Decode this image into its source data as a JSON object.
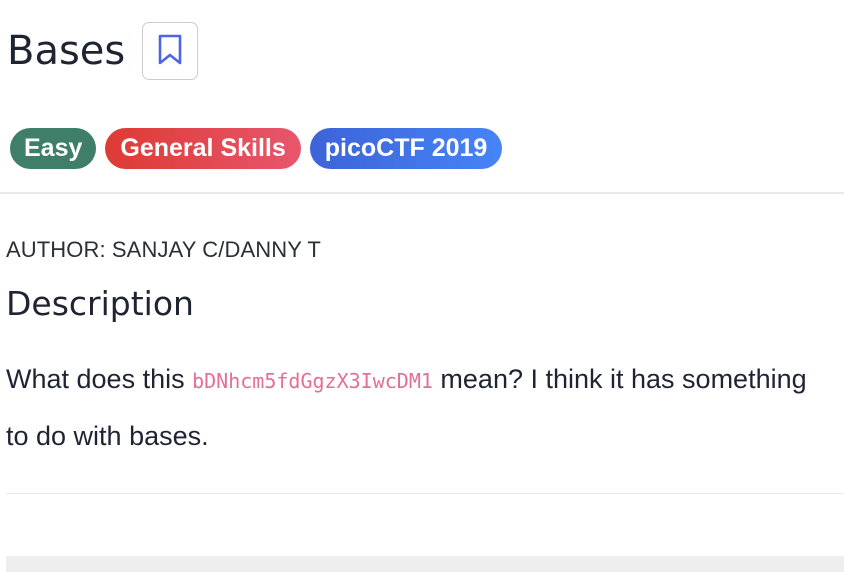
{
  "challenge": {
    "title": "Bases",
    "bookmark_icon": "bookmark-icon"
  },
  "tags": [
    {
      "label": "Easy",
      "color": "#3f7f69"
    },
    {
      "label": "General Skills",
      "color": "#dd3b34"
    },
    {
      "label": "picoCTF 2019",
      "color": "#3d63d8"
    }
  ],
  "author": "AUTHOR: SANJAY C/DANNY T",
  "description": {
    "heading": "Description",
    "text_before": "What does this ",
    "code": "bDNhcm5fdGgzX3IwcDM1",
    "text_after": " mean? I think it has something to do with bases."
  },
  "colors": {
    "accent_icon": "#4f63e8",
    "code_text": "#e36f95"
  }
}
